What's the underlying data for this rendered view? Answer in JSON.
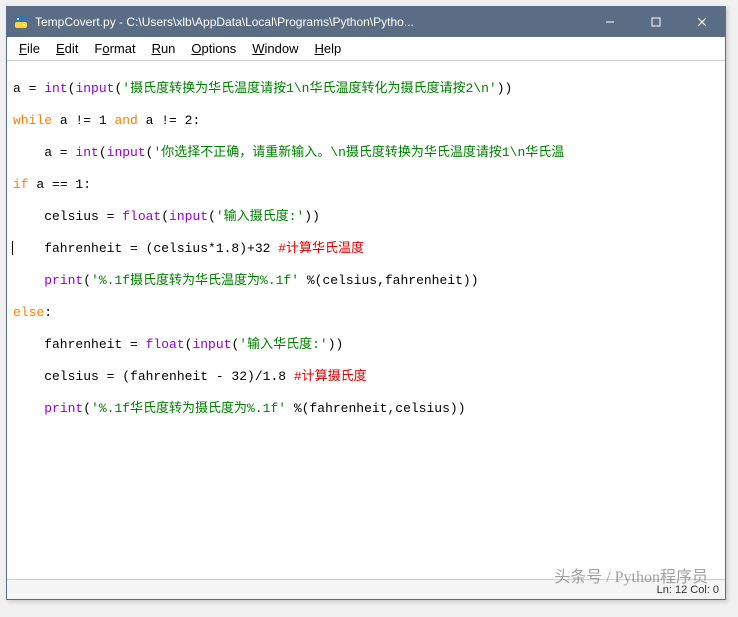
{
  "window": {
    "title": "TempCovert.py - C:\\Users\\xlb\\AppData\\Local\\Programs\\Python\\Pytho..."
  },
  "menu": {
    "file": "File",
    "edit": "Edit",
    "format": "Format",
    "run": "Run",
    "options": "Options",
    "window": "Window",
    "help": "Help"
  },
  "code": {
    "l1_a": "a = ",
    "l1_int": "int",
    "l1_p1": "(",
    "l1_input": "input",
    "l1_p2": "(",
    "l1_str": "'摄氏度转换为华氏温度请按1\\n华氏温度转化为摄氏度请按2\\n'",
    "l1_p3": "))",
    "l2_while": "while",
    "l2_mid": " a != 1 ",
    "l2_and": "and",
    "l2_end": " a != 2:",
    "l3_a": "    a = ",
    "l3_int": "int",
    "l3_p1": "(",
    "l3_input": "input",
    "l3_p2": "(",
    "l3_str": "'你选择不正确，请重新输入。\\n摄氏度转换为华氏温度请按1\\n华氏温",
    "l4_if": "if",
    "l4_end": " a == 1:",
    "l5_a": "    celsius = ",
    "l5_float": "float",
    "l5_p1": "(",
    "l5_input": "input",
    "l5_p2": "(",
    "l5_str": "'输入摄氏度:'",
    "l5_p3": "))",
    "l6": "    fahrenheit = (celsius*1.8)+32 ",
    "l6_cmt": "#计算华氏温度",
    "l7_indent": "    ",
    "l7_print": "print",
    "l7_p1": "(",
    "l7_str": "'%.1f摄氏度转为华氏温度为%.1f'",
    "l7_p2": " %(celsius,fahrenheit))",
    "l8_else": "else",
    "l8_c": ":",
    "l9_a": "    fahrenheit = ",
    "l9_float": "float",
    "l9_p1": "(",
    "l9_input": "input",
    "l9_p2": "(",
    "l9_str": "'输入华氏度:'",
    "l9_p3": "))",
    "l10": "    celsius = (fahrenheit - 32)/1.8 ",
    "l10_cmt": "#计算摄氏度",
    "l11_indent": "    ",
    "l11_print": "print",
    "l11_p1": "(",
    "l11_str": "'%.1f华氏度转为摄氏度为%.1f'",
    "l11_p2": " %(fahrenheit,celsius))"
  },
  "status": {
    "text": "Ln: 12  Col: 0"
  },
  "watermark": "头条号 / Python程序员"
}
